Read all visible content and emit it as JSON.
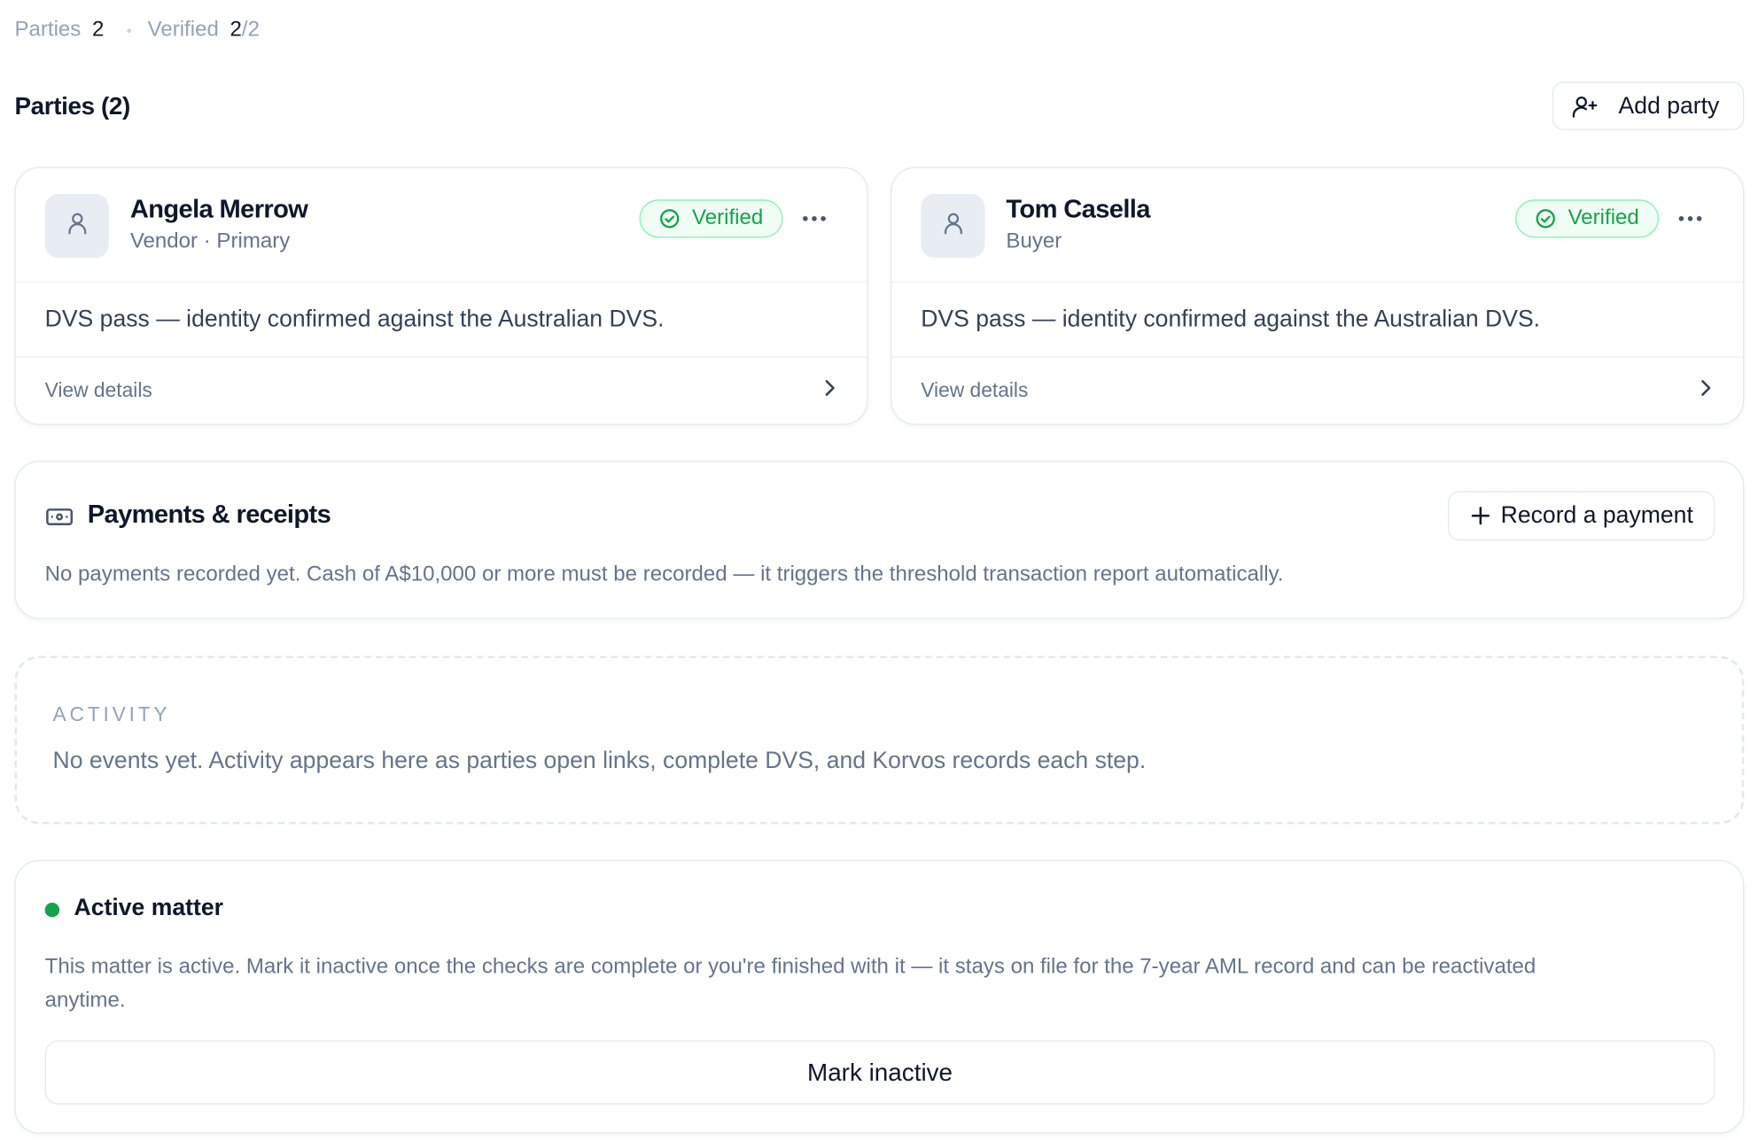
{
  "summary": {
    "parties_label": "Parties",
    "parties_count": "2",
    "verified_label": "Verified",
    "verified_count": "2",
    "verified_total": "2"
  },
  "parties_section": {
    "title": "Parties (2)",
    "add_button": "Add party"
  },
  "parties": [
    {
      "name": "Angela Merrow",
      "role": "Vendor · Primary",
      "status": "Verified",
      "description": "DVS pass — identity confirmed against the Australian DVS.",
      "link": "View details"
    },
    {
      "name": "Tom Casella",
      "role": "Buyer",
      "status": "Verified",
      "description": "DVS pass — identity confirmed against the Australian DVS.",
      "link": "View details"
    }
  ],
  "payments": {
    "title": "Payments & receipts",
    "record_button": "Record a payment",
    "empty_text": "No payments recorded yet. Cash of A$10,000 or more must be recorded — it triggers the threshold transaction report automatically."
  },
  "activity": {
    "label": "ACTIVITY",
    "empty_text": "No events yet. Activity appears here as parties open links, complete DVS, and Korvos records each step."
  },
  "matter": {
    "title": "Active matter",
    "description": "This matter is active. Mark it inactive once the checks are complete or you're finished with it — it stays on file for the 7-year AML record and can be reactivated anytime.",
    "button": "Mark inactive"
  },
  "colors": {
    "accent_green": "#16a34a",
    "badge_border": "#86efac",
    "badge_bg": "#f0fdf4",
    "text_primary": "#0f172a",
    "text_muted": "#64748b"
  },
  "icons": {
    "add_party": "user-plus-icon",
    "avatar": "user-icon",
    "verified": "check-circle-icon",
    "more": "more-horizontal-icon",
    "details": "chevron-right-icon",
    "payments": "banknote-icon",
    "record": "plus-icon"
  }
}
